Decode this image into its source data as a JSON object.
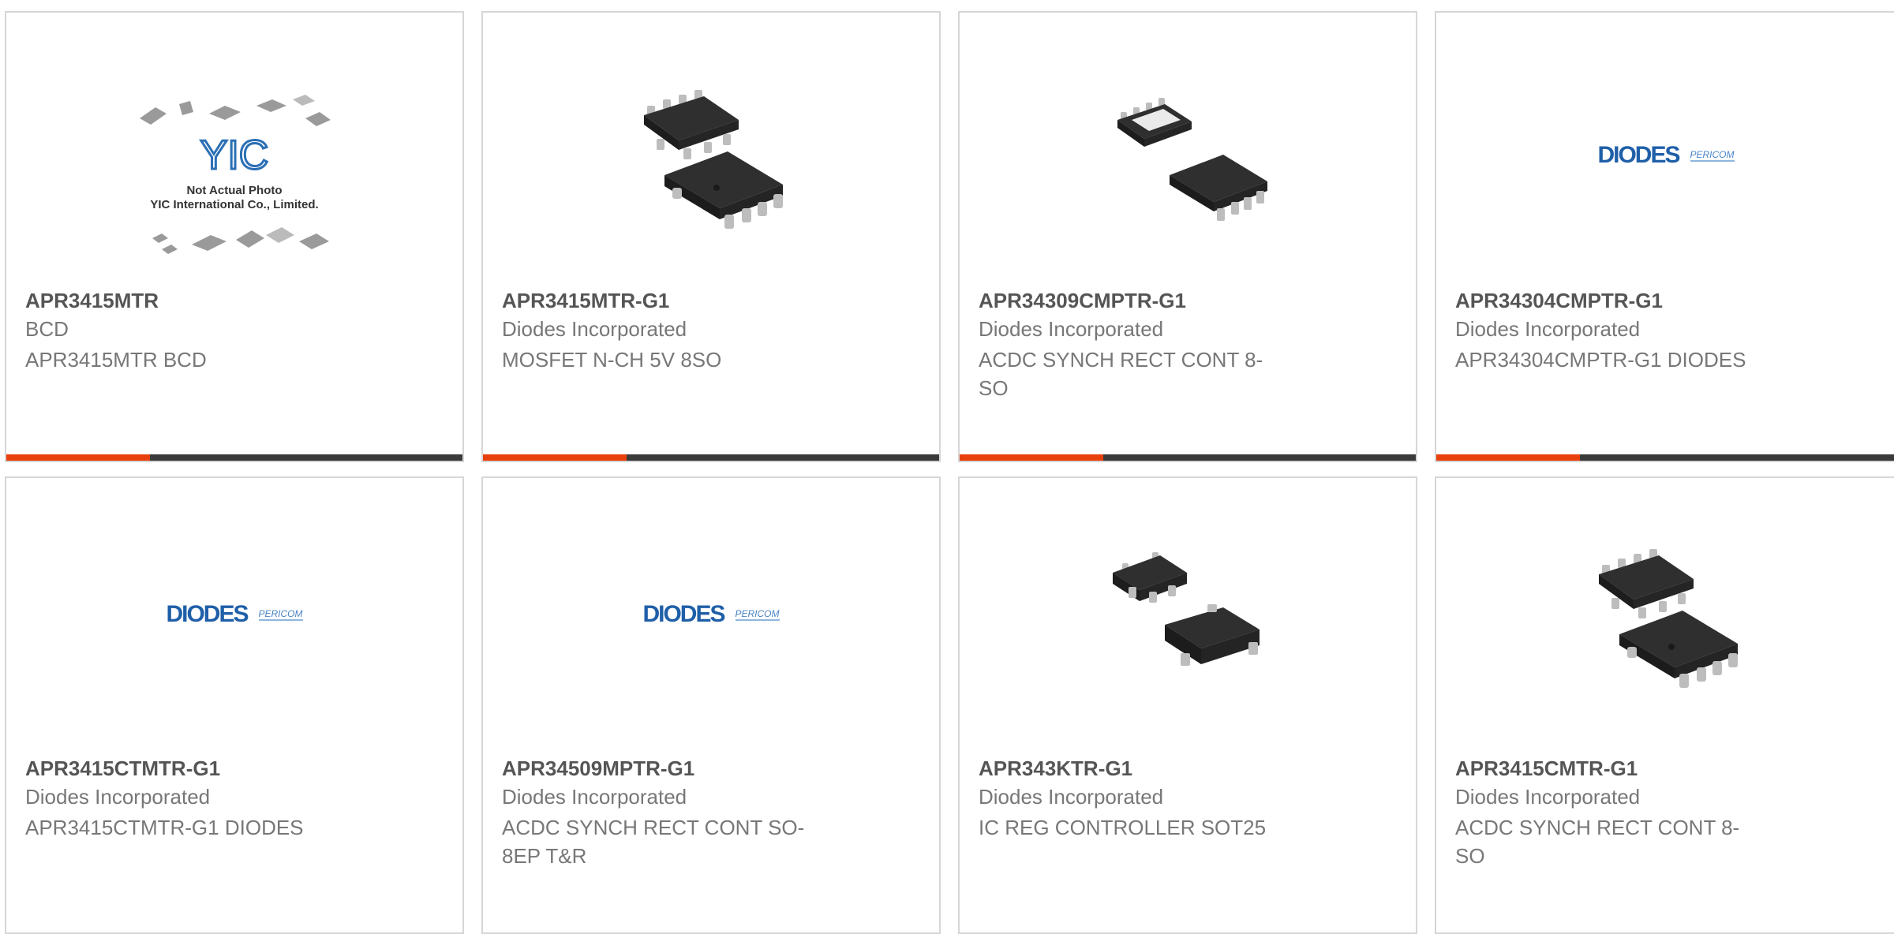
{
  "products": [
    {
      "part_number": "APR3415MTR",
      "manufacturer": "BCD",
      "description": "APR3415MTR BCD",
      "image": "not-actual-photo",
      "image_text": [
        "Not Actual Photo",
        "YIC International Co., Limited."
      ],
      "image_logo": "YIC"
    },
    {
      "part_number": "APR3415MTR-G1",
      "manufacturer": "Diodes Incorporated",
      "description": "MOSFET N-CH 5V 8SO",
      "image": "so8-chip"
    },
    {
      "part_number": "APR34309CMPTR-G1",
      "manufacturer": "Diodes Incorporated",
      "description": "ACDC SYNCH RECT CONT 8-SO",
      "image": "so8-chip"
    },
    {
      "part_number": "APR34304CMPTR-G1",
      "manufacturer": "Diodes Incorporated",
      "description": "APR34304CMPTR-G1 DIODES",
      "image": "diodes-logo",
      "image_logo": "DIODES",
      "image_logo_sub": "PERICOM"
    },
    {
      "part_number": "APR3415CTMTR-G1",
      "manufacturer": "Diodes Incorporated",
      "description": "APR3415CTMTR-G1 DIODES",
      "image": "diodes-logo",
      "image_logo": "DIODES",
      "image_logo_sub": "PERICOM"
    },
    {
      "part_number": "APR34509MPTR-G1",
      "manufacturer": "Diodes Incorporated",
      "description": "ACDC SYNCH RECT CONT SO-8EP T&R",
      "image": "diodes-logo",
      "image_logo": "DIODES",
      "image_logo_sub": "PERICOM"
    },
    {
      "part_number": "APR343KTR-G1",
      "manufacturer": "Diodes Incorporated",
      "description": "IC REG CONTROLLER SOT25",
      "image": "sot25-chip"
    },
    {
      "part_number": "APR3415CMTR-G1",
      "manufacturer": "Diodes Incorporated",
      "description": "ACDC SYNCH RECT CONT 8-SO",
      "image": "so8-chip"
    }
  ],
  "colors": {
    "accent": "#e8400c",
    "bar": "#3a3a3a",
    "border": "#d6d6d6",
    "title": "#555555",
    "text": "#777777"
  }
}
